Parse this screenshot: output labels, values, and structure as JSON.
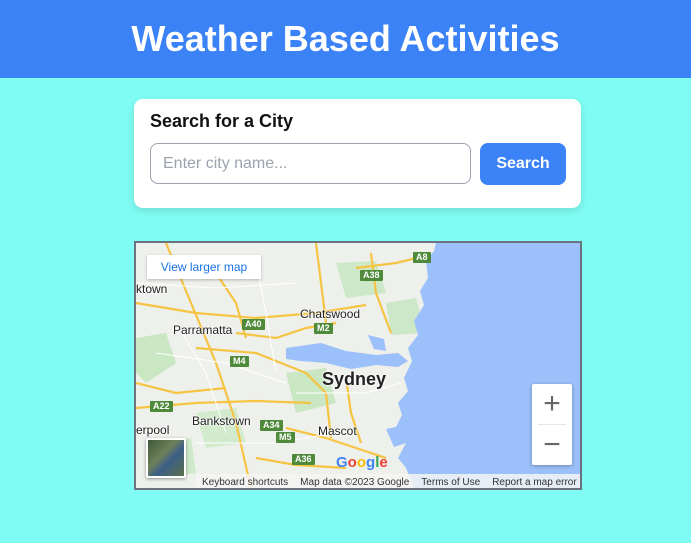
{
  "header": {
    "title": "Weather Based Activities"
  },
  "search": {
    "heading": "Search for a City",
    "placeholder": "Enter city name...",
    "button_label": "Search"
  },
  "map": {
    "larger_map_link": "View larger map",
    "zoom_in": "+",
    "zoom_out": "−",
    "logo": "Google",
    "attribution": {
      "shortcuts": "Keyboard shortcuts",
      "data": "Map data ©2023 Google",
      "terms": "Terms of Use",
      "report": "Report a map error"
    },
    "places": {
      "sydney": "Sydney",
      "chatswood": "Chatswood",
      "parramatta": "Parramatta",
      "bankstown": "Bankstown",
      "mascot": "Mascot",
      "blacktown": "ktown",
      "liverpool": "erpool"
    },
    "roads": {
      "a8": "A8",
      "a38": "A38",
      "a40": "A40",
      "m2": "M2",
      "m4": "M4",
      "a22": "A22",
      "a34": "A34",
      "m5": "M5",
      "a36": "A36"
    }
  },
  "colors": {
    "header_bg": "#3b82f6",
    "page_bg": "#7ffcf3",
    "button_bg": "#3b82f6",
    "water": "#9cc0f9"
  }
}
